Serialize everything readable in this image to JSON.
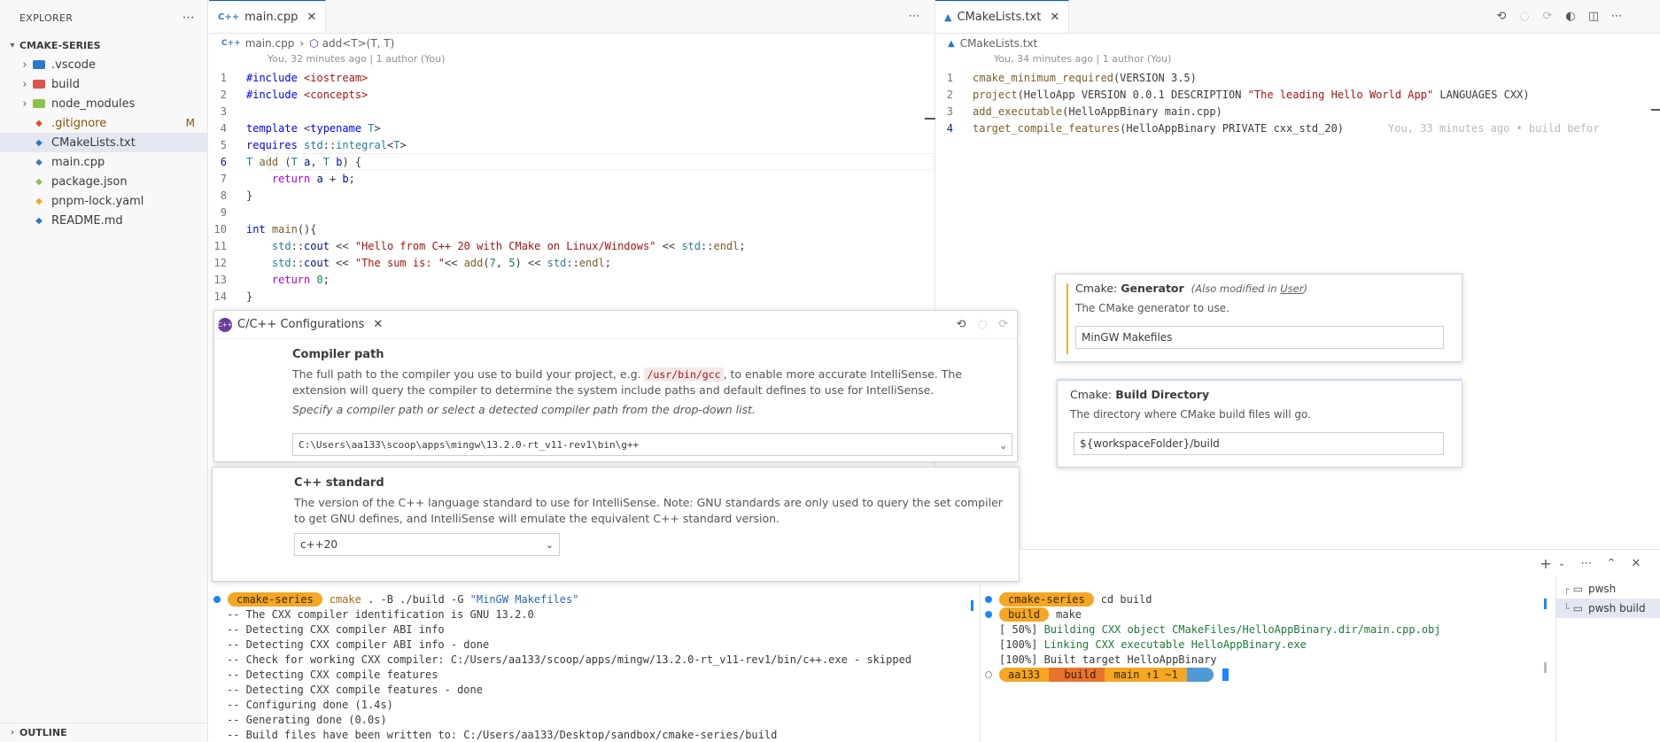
{
  "explorer": {
    "title": "EXPLORER",
    "more_icon": "⋯",
    "project": "CMAKE-SERIES",
    "items": [
      {
        "label": ".vscode",
        "type": "folder",
        "icon_color": "#2a7ac7"
      },
      {
        "label": "build",
        "type": "folder",
        "icon_color": "#d9534f"
      },
      {
        "label": "node_modules",
        "type": "folder",
        "icon_color": "#8bc34a"
      },
      {
        "label": ".gitignore",
        "type": "file",
        "icon_color": "#e44d26",
        "badge": "M"
      },
      {
        "label": "CMakeLists.txt",
        "type": "file",
        "icon_color": "#2a7ac7"
      },
      {
        "label": "main.cpp",
        "type": "file",
        "icon_color": "#4079c2"
      },
      {
        "label": "package.json",
        "type": "file",
        "icon_color": "#8bc34a"
      },
      {
        "label": "pnpm-lock.yaml",
        "type": "file",
        "icon_color": "#f5a623"
      },
      {
        "label": "README.md",
        "type": "file",
        "icon_color": "#2a7ac7"
      }
    ],
    "outline": "OUTLINE"
  },
  "left_editor": {
    "tab_label": "main.cpp",
    "tab_icon": "C++",
    "breadcrumb_file": "main.cpp",
    "breadcrumb_symbol": "add<T>(T, T)",
    "blame": "You, 32 minutes ago | 1 author (You)",
    "lines": [
      "1",
      "2",
      "3",
      "4",
      "5",
      "6",
      "7",
      "8",
      "9",
      "10",
      "11",
      "12",
      "13",
      "14"
    ]
  },
  "right_editor": {
    "tab_label": "CMakeLists.txt",
    "breadcrumb_file": "CMakeLists.txt",
    "blame": "You, 34 minutes ago | 1 author (You)",
    "inline_blame": "You, 33 minutes ago • build befor",
    "lines": [
      "1",
      "2",
      "3",
      "4"
    ]
  },
  "cpp_config": {
    "tab_label": "C/C++ Configurations",
    "compiler_title": "Compiler path",
    "compiler_desc_1": "The full path to the compiler you use to build your project, e.g. ",
    "compiler_desc_code": "/usr/bin/gcc",
    "compiler_desc_2": ", to enable more accurate IntelliSense. The extension will query the compiler to determine the system include paths and default defines to use for IntelliSense.",
    "compiler_hint": "Specify a compiler path or select a detected compiler path from the drop-down list.",
    "compiler_value": "C:\\Users\\aa133\\scoop\\apps\\mingw\\13.2.0-rt_v11-rev1\\bin\\g++",
    "std_title": "C++ standard",
    "std_desc": "The version of the C++ language standard to use for IntelliSense. Note: GNU standards are only used to query the set compiler to get GNU defines, and IntelliSense will emulate the equivalent C++ standard version.",
    "std_value": "c++20"
  },
  "cmake_settings": {
    "generator_prefix": "Cmake: ",
    "generator_title": "Generator",
    "generator_modified_1": "(Also modified in ",
    "generator_modified_link": "User",
    "generator_modified_2": ")",
    "generator_desc": "The CMake generator to use.",
    "generator_value": "MinGW Makefiles",
    "builddir_prefix": "Cmake: ",
    "builddir_title": "Build Directory",
    "builddir_desc": "The directory where CMake build files will go.",
    "builddir_value": "${workspaceFolder}/build"
  },
  "terminal_left": {
    "prompt": "cmake-series",
    "command_1": "cmake",
    "command_2": ". -B ./build -G ",
    "command_3": "\"MinGW Makefiles\"",
    "output": [
      "-- The CXX compiler identification is GNU 13.2.0",
      "-- Detecting CXX compiler ABI info",
      "-- Detecting CXX compiler ABI info - done",
      "-- Check for working CXX compiler: C:/Users/aa133/scoop/apps/mingw/13.2.0-rt_v11-rev1/bin/c++.exe - skipped",
      "-- Detecting CXX compile features",
      "-- Detecting CXX compile features - done",
      "-- Configuring done (1.4s)",
      "-- Generating done (0.0s)",
      "-- Build files have been written to: C:/Users/aa133/Desktop/sandbox/cmake-series/build"
    ]
  },
  "terminal_right": {
    "prompt_1": "cmake-series",
    "command_1": "cd build",
    "prompt_2": "build",
    "command_2": "make",
    "line_1a": "[ 50%] ",
    "line_1b": "Building CXX object CMakeFiles/HelloAppBinary.dir/main.cpp.obj",
    "line_2a": "[100%] ",
    "line_2b": "Linking CXX executable HelloAppBinary.exe",
    "line_3": "[100%] Built target HelloAppBinary",
    "seg_user": "aa133",
    "seg_dir": " build",
    "seg_git": "main ↑1 ~1",
    "seg_end": ""
  },
  "terminal_tabs": {
    "items": [
      "pwsh",
      "pwsh build"
    ]
  },
  "colors": {
    "accent": "#005fb8",
    "prompt_orange": "#f5a623",
    "prompt_red": "#e8732c",
    "prompt_blue": "#4e9ad7"
  }
}
